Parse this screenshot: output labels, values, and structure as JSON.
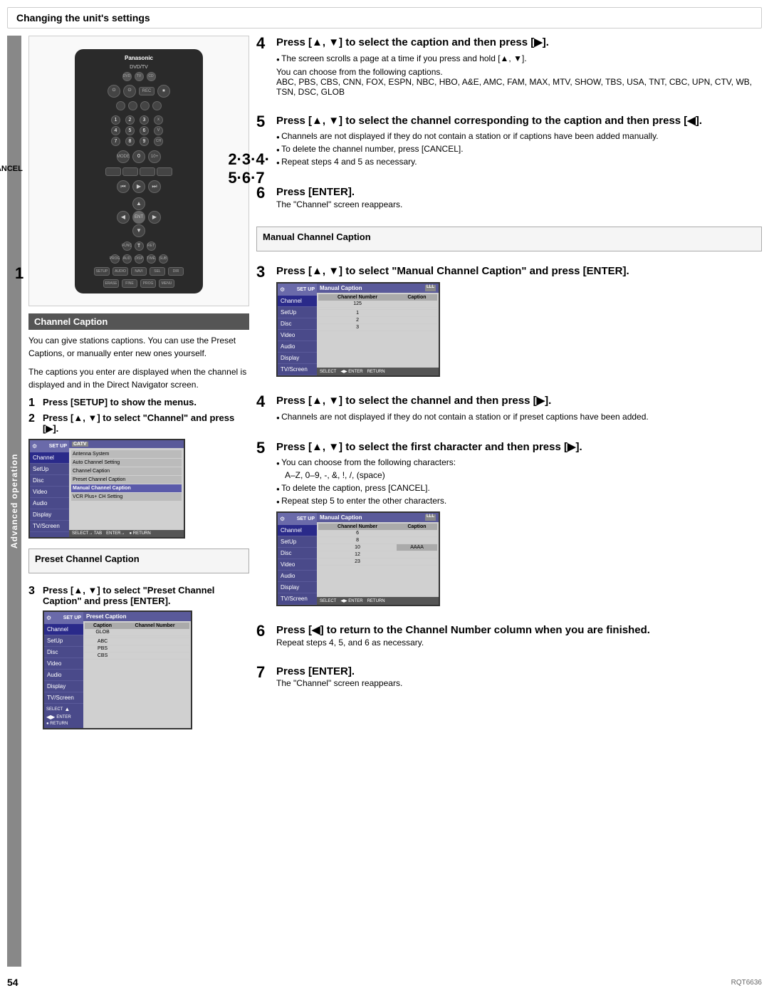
{
  "page": {
    "title": "Changing the unit's settings",
    "page_number": "54",
    "product_code": "RQT6636"
  },
  "sidebar": {
    "label": "Advanced operation"
  },
  "remote": {
    "brand": "Panasonic",
    "brand_sub": "DVD/TV",
    "cancel_label": "CANCEL",
    "steps_label": "2·3·4·\n5·6·7",
    "step1_label": "1"
  },
  "channel_caption": {
    "section_title": "Channel Caption",
    "description1": "You can give stations captions. You can use the Preset Captions, or manually enter new ones yourself.",
    "description2": "The captions you enter are displayed when the channel is displayed and in the Direct Navigator screen.",
    "step1_text": "Press [SETUP] to show the menus.",
    "step2_text": "Press [▲, ▼] to select \"Channel\" and press [▶]."
  },
  "setup_menu": {
    "title": "SET UP",
    "badge": "CATV",
    "items": [
      "Antenna System",
      "Auto Channel Setting",
      "Channel Caption",
      "Preset Channel Caption",
      "Manual Channel Caption",
      "VCR Plus+ CH Setting"
    ],
    "active_item": "Manual Channel Caption",
    "bottom_labels": [
      "SELECT→ TAB",
      "ENTER→ ● RETURN"
    ]
  },
  "preset_caption": {
    "box_title": "Preset Channel Caption",
    "step3_text": "Press [▲, ▼] to select \"Preset Channel Caption\" and press [ENTER].",
    "screen_title": "Preset Caption",
    "columns": [
      "Caption",
      "Channel Number"
    ],
    "rows": [
      {
        "caption": "GLOB",
        "channel": ""
      },
      {
        "caption": "",
        "channel": ""
      },
      {
        "caption": "ABC",
        "channel": ""
      },
      {
        "caption": "PBS",
        "channel": ""
      },
      {
        "caption": "CBS",
        "channel": ""
      }
    ]
  },
  "right_column": {
    "step4_title": "Press [▲, ▼] to select the caption and then press [▶].",
    "step4_bullet1": "The screen scrolls a page at a time if you press and hold [▲, ▼].",
    "step4_note": "You can choose from the following captions.",
    "step4_captions": "ABC, PBS, CBS, CNN, FOX, ESPN, NBC, HBO, A&E, AMC, FAM, MAX, MTV, SHOW, TBS, USA, TNT, CBC, UPN, CTV, WB, TSN, DSC, GLOB",
    "step5_title": "Press [▲, ▼] to select the channel corresponding to the caption and then press [◀].",
    "step5_bullet1": "Channels are not displayed if they do not contain a station or if captions have been added manually.",
    "step5_bullet2": "To delete the channel number, press [CANCEL].",
    "step5_bullet3": "Repeat steps 4 and 5 as necessary.",
    "step6_title": "Press [ENTER].",
    "step6_note": "The \"Channel\" screen reappears.",
    "manual_caption_box_title": "Manual Channel Caption",
    "step3_manual_title": "Press [▲, ▼] to select \"Manual Channel Caption\" and press [ENTER].",
    "step4_manual_title": "Press [▲, ▼] to select the channel and then press [▶].",
    "step4_manual_bullet1": "Channels are not displayed if they do not contain a station or if preset captions have been added.",
    "step5_manual_title": "Press [▲, ▼] to select the first character and then press [▶].",
    "step5_manual_bullet1": "You can choose from the following characters:",
    "step5_manual_chars": "A–Z, 0–9, -, &, !, /, (space)",
    "step5_manual_bullet2": "To delete the caption, press [CANCEL].",
    "step5_manual_bullet3": "Repeat step 5 to enter the other characters.",
    "step6_manual_title": "Press [◀] to return to the Channel Number column when you are finished.",
    "step6_manual_note": "Repeat steps 4, 5, and 6 as necessary.",
    "step7_manual_title": "Press [ENTER].",
    "step7_manual_note": "The \"Channel\" screen reappears.",
    "manual_screen_title": "Manual Caption",
    "manual_cols": [
      "Channel Number",
      "Caption"
    ],
    "manual_rows1": [
      {
        "ch": "125",
        "cap": ""
      },
      {
        "ch": "",
        "cap": ""
      },
      {
        "ch": "1",
        "cap": ""
      },
      {
        "ch": "2",
        "cap": ""
      },
      {
        "ch": "3",
        "cap": ""
      }
    ],
    "manual_rows2": [
      {
        "ch": "6",
        "cap": ""
      },
      {
        "ch": "8",
        "cap": ""
      },
      {
        "ch": "10",
        "cap": "AAAA"
      },
      {
        "ch": "12",
        "cap": ""
      },
      {
        "ch": "23",
        "cap": ""
      }
    ]
  }
}
